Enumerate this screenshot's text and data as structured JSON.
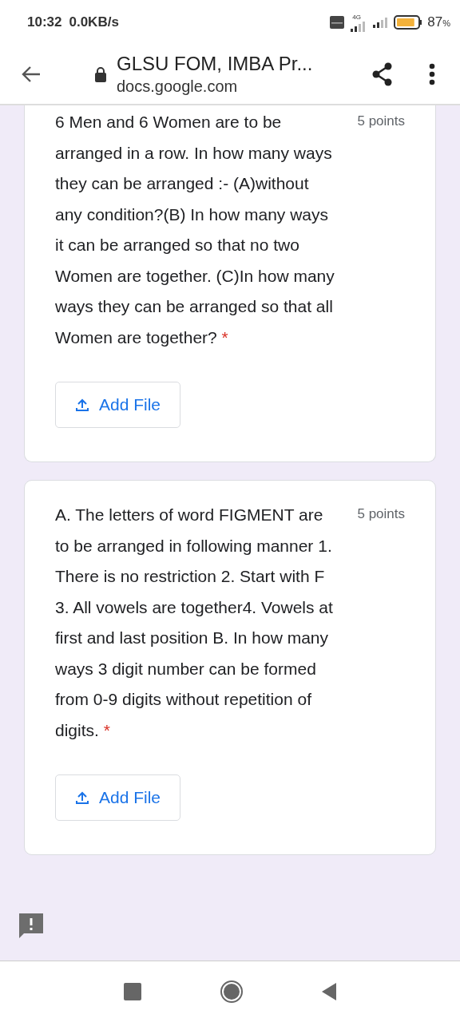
{
  "status_bar": {
    "time": "10:32",
    "speed": "0.0KB/s",
    "network": "4G",
    "battery": "87",
    "battery_unit": "%"
  },
  "toolbar": {
    "title": "GLSU FOM, IMBA Pr...",
    "url": "docs.google.com"
  },
  "questions": [
    {
      "text": "6 Men and 6 Women are to be arranged in a row. In how many ways they can be arranged :- (A)without any condition?(B) In how many ways it can be arranged so that no two Women are together. (C)In how many ways they can be arranged so that all Women are together?",
      "points": "5 points",
      "required": true,
      "required_mark": "*",
      "button": "Add File"
    },
    {
      "text": "A. The letters of word FIGMENT are to be arranged in following manner 1. There is no restriction 2. Start with F 3. All vowels are together4. Vowels at first and last position B. In how many ways 3 digit number can be formed from 0-9 digits without repetition of digits.",
      "points": "5 points",
      "required": true,
      "required_mark": "*",
      "button": "Add File"
    }
  ]
}
